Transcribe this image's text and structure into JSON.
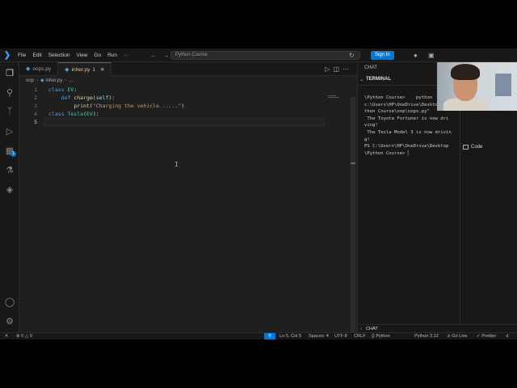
{
  "titlebar": {
    "menu": [
      "File",
      "Edit",
      "Selection",
      "View",
      "Go",
      "Run",
      "···"
    ],
    "search": "Python Course",
    "signin": "Sign In"
  },
  "tabs": [
    {
      "name": "oops.py",
      "active": false
    },
    {
      "name": "inher.py",
      "active": true,
      "modified": "1"
    }
  ],
  "breadcrumb": [
    "oop",
    "inher.py",
    "..."
  ],
  "editor": {
    "line_numbers": [
      "1",
      "2",
      "3",
      "4",
      "5"
    ],
    "lines": [
      {
        "tokens": [
          [
            "kw",
            "class "
          ],
          [
            "cls",
            "EV"
          ],
          [
            "plain",
            ":"
          ]
        ]
      },
      {
        "tokens": [
          [
            "plain",
            "    "
          ],
          [
            "kw",
            "def "
          ],
          [
            "fn",
            "charge"
          ],
          [
            "plain",
            "("
          ],
          [
            "param",
            "self"
          ],
          [
            "plain",
            "):"
          ]
        ]
      },
      {
        "tokens": [
          [
            "plain",
            "        "
          ],
          [
            "fn",
            "print"
          ],
          [
            "plain",
            "("
          ],
          [
            "str",
            "\"Charging the vehicle......\""
          ],
          [
            "plain",
            ")"
          ]
        ]
      },
      {
        "tokens": [
          [
            "kw",
            "class "
          ],
          [
            "cls",
            "Tesla"
          ],
          [
            "plain",
            "("
          ],
          [
            "cls",
            "EV"
          ],
          [
            "plain",
            "):"
          ]
        ]
      },
      {
        "tokens": [
          [
            "plain",
            "    "
          ]
        ]
      }
    ]
  },
  "right_panel": {
    "chat_title": "CHAT",
    "terminal_title": "TERMINAL",
    "terminal_lines": [
      "\\Python Course>    python",
      "c:\\Users\\HP\\OneDrive\\Desktop\\Py",
      "thon Course\\oop\\oops.py\"",
      " The Toyota Fortuner is now dri",
      "ving!",
      " The Tesla Model 3 is now drivin",
      "g!",
      "PS C:\\Users\\HP\\OneDrive\\Desktop",
      "\\Python Course> ▏"
    ],
    "code_label": "Code",
    "chat_bottom": "CHAT"
  },
  "statusbar": {
    "errors": "0",
    "warnings": "0",
    "position": "Ln 5, Col 5",
    "spaces": "Spaces: 4",
    "encoding": "UTF-8",
    "eol": "CRLF",
    "language": "Python",
    "interpreter": "Python 3.12",
    "golive": "Go Live",
    "prettier": "Prettier"
  },
  "colors": {
    "accent": "#0078d4",
    "editor_bg": "#1f1f1f",
    "chrome_bg": "#181818"
  }
}
